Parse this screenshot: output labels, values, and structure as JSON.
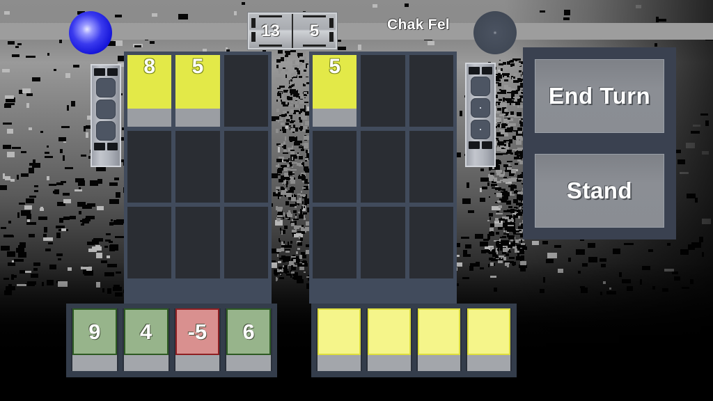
{
  "header": {
    "score_left": "13",
    "score_right": "5",
    "player_name": "Chak Fel",
    "left_orb_icon": "blue-energy-orb-icon",
    "right_orb_icon": "gray-inactive-orb-icon",
    "left_tower_icon": "left-pillar-tower-icon",
    "right_tower_icon": "right-pillar-tower-icon"
  },
  "colors": {
    "board_frame": "#414b5c",
    "board_cell": "#2a2d33",
    "card_yellow": "#e3e948",
    "card_yellow_pale": "#f5f58a",
    "card_green": "#97b48b",
    "card_green_border": "#2d5a22",
    "card_red": "#d9908f",
    "card_red_border": "#8e1f22",
    "card_strip": "#9b9ea3",
    "panel": "#3a4150",
    "button": "#8a8d93",
    "accent_blue": "#1414d8",
    "header_band": "#9d9d9d"
  },
  "boards": {
    "left": {
      "rows": 3,
      "cols": 3,
      "cells": [
        {
          "value": "8",
          "type": "played",
          "color": "#e3e948"
        },
        {
          "value": "5",
          "type": "played",
          "color": "#e3e948"
        },
        {
          "value": "",
          "type": "empty",
          "color": ""
        },
        {
          "value": "",
          "type": "empty",
          "color": ""
        },
        {
          "value": "",
          "type": "empty",
          "color": ""
        },
        {
          "value": "",
          "type": "empty",
          "color": ""
        },
        {
          "value": "",
          "type": "empty",
          "color": ""
        },
        {
          "value": "",
          "type": "empty",
          "color": ""
        },
        {
          "value": "",
          "type": "empty",
          "color": ""
        }
      ]
    },
    "right": {
      "rows": 3,
      "cols": 3,
      "cells": [
        {
          "value": "5",
          "type": "played",
          "color": "#e3e948"
        },
        {
          "value": "",
          "type": "empty",
          "color": ""
        },
        {
          "value": "",
          "type": "empty",
          "color": ""
        },
        {
          "value": "",
          "type": "empty",
          "color": ""
        },
        {
          "value": "",
          "type": "empty",
          "color": ""
        },
        {
          "value": "",
          "type": "empty",
          "color": ""
        },
        {
          "value": "",
          "type": "empty",
          "color": ""
        },
        {
          "value": "",
          "type": "empty",
          "color": ""
        },
        {
          "value": "",
          "type": "empty",
          "color": ""
        }
      ]
    }
  },
  "hands": {
    "player": [
      {
        "value": "9",
        "color": "#97b48b",
        "border": "#2d5a22",
        "face_up": true
      },
      {
        "value": "4",
        "color": "#97b48b",
        "border": "#2d5a22",
        "face_up": true
      },
      {
        "value": "-5",
        "color": "#d9908f",
        "border": "#8e1f22",
        "face_up": true
      },
      {
        "value": "6",
        "color": "#97b48b",
        "border": "#2d5a22",
        "face_up": true
      }
    ],
    "opponent": [
      {
        "value": "",
        "color": "#f5f58a",
        "border": "#dede3c",
        "face_up": false
      },
      {
        "value": "",
        "color": "#f5f58a",
        "border": "#dede3c",
        "face_up": false
      },
      {
        "value": "",
        "color": "#f5f58a",
        "border": "#dede3c",
        "face_up": false
      },
      {
        "value": "",
        "color": "#f5f58a",
        "border": "#dede3c",
        "face_up": false
      }
    ]
  },
  "actions": {
    "end_turn_label": "End Turn",
    "stand_label": "Stand"
  }
}
